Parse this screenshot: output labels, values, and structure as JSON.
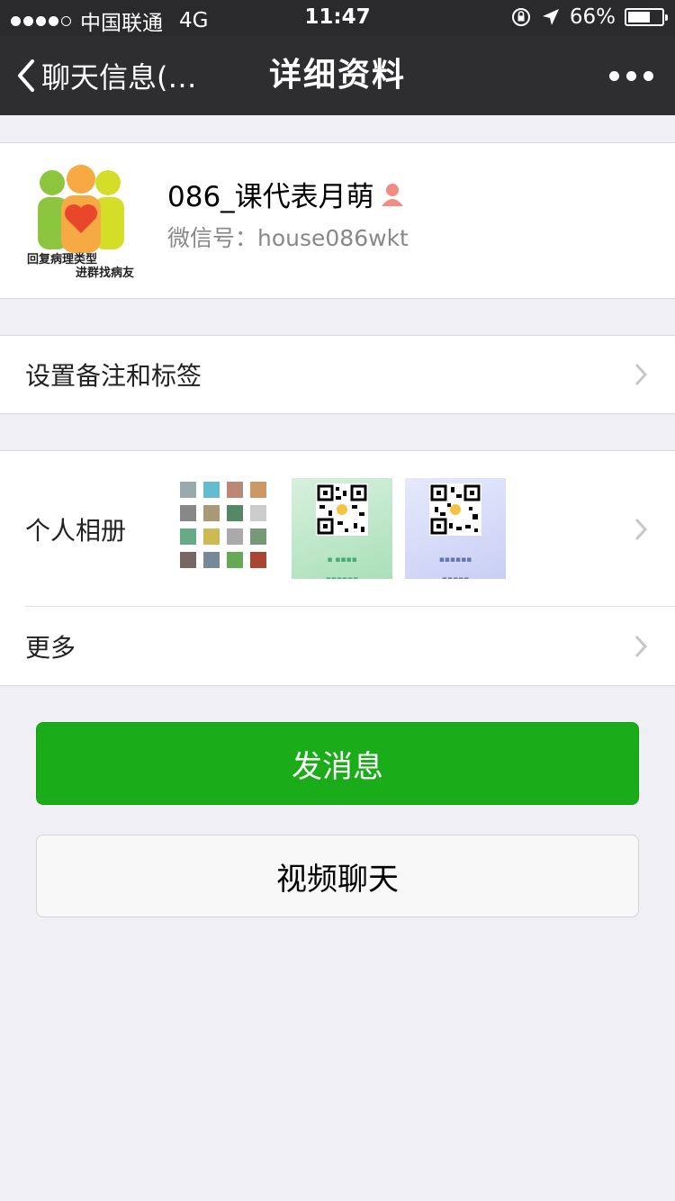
{
  "status_bar": {
    "carrier": "中国联通",
    "network": "4G",
    "time": "11:47",
    "battery": "66%",
    "battery_level": 0.66
  },
  "nav": {
    "back_label": "聊天信息(…",
    "title": "详细资料",
    "more_icon": "more-dots-icon"
  },
  "profile": {
    "name": "086_课代表月萌",
    "gender_icon": "female-user-icon",
    "wechat_id_label": "微信号：",
    "wechat_id": "house086wkt",
    "avatar_caption_line1": "回复病理类型",
    "avatar_caption_line2": "进群找病友"
  },
  "rows": {
    "remark_label": "设置备注和标签",
    "album_label": "个人相册",
    "more_label": "更多"
  },
  "buttons": {
    "send_message": "发消息",
    "video_chat": "视频聊天"
  },
  "colors": {
    "nav_bg": "#2e2e31",
    "primary_green": "#1aad19",
    "page_bg": "#efeff4"
  }
}
